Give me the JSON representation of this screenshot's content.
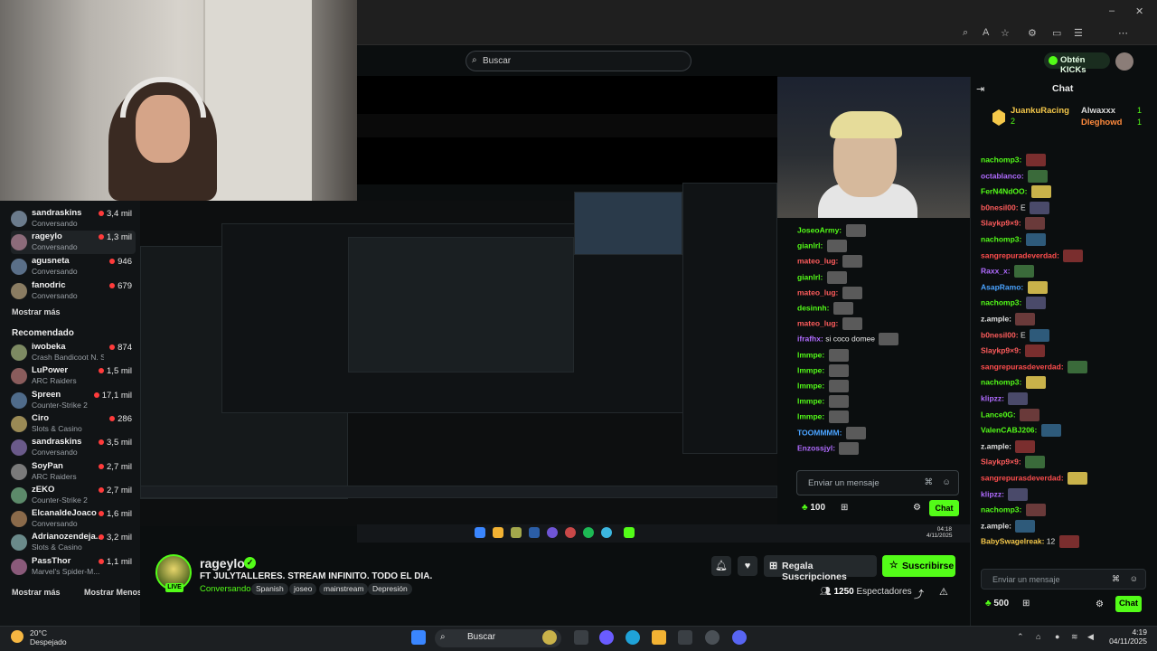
{
  "browser": {
    "search_placeholder": "Buscar",
    "get_kicks_label": "Obtén KICKs"
  },
  "sidebar": {
    "following": [
      {
        "name": "sandraskins",
        "category": "Conversando",
        "viewers": "3,4 mil"
      },
      {
        "name": "rageylo",
        "category": "Conversando",
        "viewers": "1,3 mil"
      },
      {
        "name": "agusneta",
        "category": "Conversando",
        "viewers": "946"
      },
      {
        "name": "fanodric",
        "category": "Conversando",
        "viewers": "679"
      }
    ],
    "show_more": "Mostrar más",
    "recommended_title": "Recomendado",
    "recommended": [
      {
        "name": "iwobeka",
        "category": "Crash Bandicoot N. Sa...",
        "viewers": "874"
      },
      {
        "name": "LuPower",
        "category": "ARC Raiders",
        "viewers": "1,5 mil"
      },
      {
        "name": "Spreen",
        "category": "Counter-Strike 2",
        "viewers": "17,1 mil"
      },
      {
        "name": "Ciro",
        "category": "Slots & Casino",
        "viewers": "286"
      },
      {
        "name": "sandraskins",
        "category": "Conversando",
        "viewers": "3,5 mil"
      },
      {
        "name": "SoyPan",
        "category": "ARC Raiders",
        "viewers": "2,7 mil"
      },
      {
        "name": "zEKO",
        "category": "Counter-Strike 2",
        "viewers": "2,7 mil"
      },
      {
        "name": "ElcanaldeJoaco",
        "category": "Conversando",
        "viewers": "1,6 mil"
      },
      {
        "name": "Adrianozendeja...",
        "category": "Slots & Casino",
        "viewers": "3,2 mil"
      },
      {
        "name": "PassThor",
        "category": "Marvel's Spider-M...",
        "viewers": "1,1 mil"
      }
    ],
    "show_more_bottom": "Mostrar más",
    "show_less": "Mostrar Menos"
  },
  "stream": {
    "streamer": "rageylo",
    "live": "LIVE",
    "title": "FT JULYTALLERES. STREAM INFINITO. TODO EL DIA.",
    "category": "Conversando",
    "tags": [
      "Spanish",
      "joseo",
      "mainstream",
      "Depresión"
    ],
    "gift_label": "Regala Suscripciones",
    "subscribe_label": "Suscribirse",
    "viewers": "1250",
    "viewers_label": "Espectadores"
  },
  "chat": {
    "title": "Chat",
    "pinned": {
      "user": "JuankuRacing",
      "count": "2",
      "gifter1": "Alwaxxx",
      "gifter1_count": "1",
      "gifter2": "Dleghowd",
      "gifter2_count": "1"
    },
    "messages": [
      {
        "user": "nachomp3:",
        "color": "#53fc18",
        "text": ""
      },
      {
        "user": "octablanco:",
        "color": "#b06bff",
        "text": ""
      },
      {
        "user": "FerN4NdOO:",
        "color": "#53fc18",
        "text": ""
      },
      {
        "user": "b0nesil00:",
        "color": "#ff5c5c",
        "text": "E"
      },
      {
        "user": "Slaykp9×9:",
        "color": "#ff5c5c",
        "text": ""
      },
      {
        "user": "nachomp3:",
        "color": "#53fc18",
        "text": ""
      },
      {
        "user": "sangrepuradeverdad:",
        "color": "#ff4d4d",
        "text": ""
      },
      {
        "user": "Raxx_x:",
        "color": "#b06bff",
        "text": ""
      },
      {
        "user": "AsapRamo:",
        "color": "#4aa3ff",
        "text": ""
      },
      {
        "user": "nachomp3:",
        "color": "#53fc18",
        "text": ""
      },
      {
        "user": "z.ample:",
        "color": "#e0e0e0",
        "text": ""
      },
      {
        "user": "b0nesil00:",
        "color": "#ff5c5c",
        "text": "E"
      },
      {
        "user": "Slaykp9×9:",
        "color": "#ff5c5c",
        "text": ""
      },
      {
        "user": "sangrepurasdeverdad:",
        "color": "#ff4d4d",
        "text": ""
      },
      {
        "user": "nachomp3:",
        "color": "#53fc18",
        "text": ""
      },
      {
        "user": "klipzz:",
        "color": "#b06bff",
        "text": ""
      },
      {
        "user": "Lance0G:",
        "color": "#53fc18",
        "text": ""
      },
      {
        "user": "ValenCABJ206:",
        "color": "#53fc18",
        "text": ""
      },
      {
        "user": "z.ample:",
        "color": "#e0e0e0",
        "text": ""
      },
      {
        "user": "Slaykp9×9:",
        "color": "#ff5c5c",
        "text": ""
      },
      {
        "user": "sangrepurasdeverdad:",
        "color": "#ff4d4d",
        "text": ""
      },
      {
        "user": "klipzz:",
        "color": "#b06bff",
        "text": ""
      },
      {
        "user": "nachomp3:",
        "color": "#53fc18",
        "text": ""
      },
      {
        "user": "z.ample:",
        "color": "#e0e0e0",
        "text": ""
      },
      {
        "user": "BabySwagelreak:",
        "color": "#f5c84a",
        "text": "12"
      }
    ],
    "input_placeholder": "Enviar un mensaje",
    "kicks": "500",
    "send_label": "Chat"
  },
  "inner_chat": {
    "messages": [
      {
        "user": "JoseoArmy:",
        "color": "#53fc18"
      },
      {
        "user": "gianlrl:",
        "color": "#53fc18"
      },
      {
        "user": "mateo_lug:",
        "color": "#ff5c5c"
      },
      {
        "user": "gianlrl:",
        "color": "#53fc18"
      },
      {
        "user": "mateo_lug:",
        "color": "#ff5c5c"
      },
      {
        "user": "desinnh:",
        "color": "#53fc18"
      },
      {
        "user": "mateo_lug:",
        "color": "#ff5c5c"
      },
      {
        "user": "ifrafhx:",
        "color": "#b06bff",
        "text": "si coco domee"
      },
      {
        "user": "lmmpe:",
        "color": "#53fc18"
      },
      {
        "user": "lmmpe:",
        "color": "#53fc18"
      },
      {
        "user": "lmmpe:",
        "color": "#53fc18"
      },
      {
        "user": "lmmpe:",
        "color": "#53fc18"
      },
      {
        "user": "lmmpe:",
        "color": "#53fc18"
      },
      {
        "user": "TOOMMMM:",
        "color": "#4aa3ff"
      },
      {
        "user": "Enzossjyl:",
        "color": "#b06bff"
      }
    ],
    "input_placeholder": "Enviar un mensaje",
    "kicks": "100",
    "send_label": "Chat"
  },
  "taskbar": {
    "temp": "20°C",
    "weather": "Despejado",
    "search": "Buscar",
    "time": "4:19",
    "date": "04/11/2025"
  },
  "colors": {
    "accent": "#53fc18",
    "bg": "#0b0e0f"
  }
}
